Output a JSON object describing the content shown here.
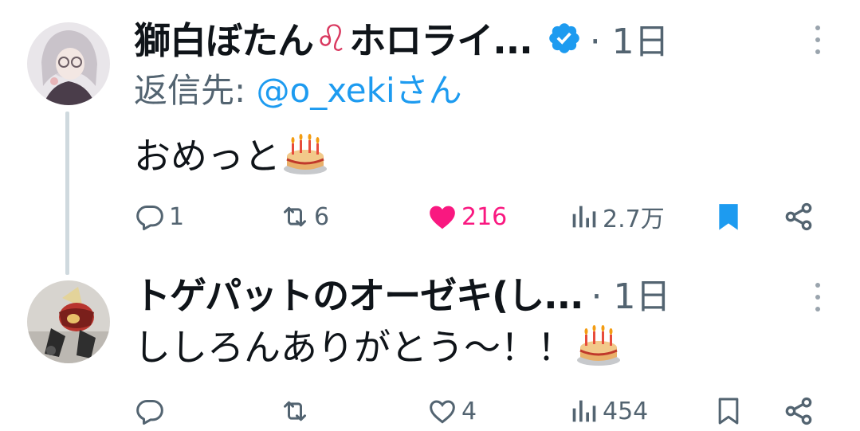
{
  "tweets": [
    {
      "author_name": "獅白ぼたん",
      "author_suffix_icon": "leo-zodiac-icon",
      "author_org": "ホロライ...",
      "verified": true,
      "time": "· 1日",
      "reply_to_label": "返信先: ",
      "reply_to_handle": "@o_xeki",
      "reply_to_suffix": "さん",
      "text": "おめっと",
      "emoji": "birthday-cake-icon",
      "actions": {
        "replies": "1",
        "retweets": "6",
        "likes": "216",
        "liked": true,
        "views": "2.7万",
        "bookmarked": true
      }
    },
    {
      "author_name": "トゲパットのオーゼキ(し...",
      "time": "· 1日",
      "text": "ししろんありがとう～！！",
      "emoji": "birthday-cake-icon",
      "actions": {
        "replies": "",
        "retweets": "",
        "likes": "4",
        "liked": false,
        "views": "454",
        "bookmarked": false
      }
    }
  ],
  "colors": {
    "like": "#f91880",
    "bookmark": "#1d9bf0",
    "verified": "#1d9bf0",
    "muted": "#536471",
    "thread_line": "#cfd9de"
  }
}
